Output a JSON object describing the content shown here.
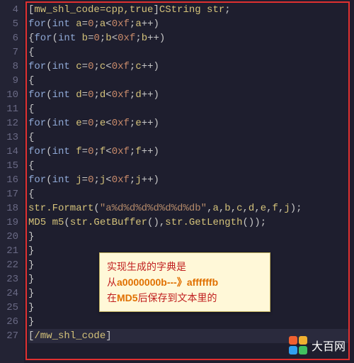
{
  "gutter": {
    "start": 4,
    "end": 27
  },
  "code_lines": {
    "l4": "[mw_shl_code=cpp,true]CString str;",
    "l5": "for(int a=0;a<0xf;a++)",
    "l6": "{for(int b=0;b<0xf;b++)",
    "l7": "{",
    "l8": "for(int c=0;c<0xf;c++)",
    "l9": "{",
    "l10": "for(int d=0;d<0xf;d++)",
    "l11": "{",
    "l12": "for(int e=0;e<0xf;e++)",
    "l13": "{",
    "l14": "for(int f=0;f<0xf;f++)",
    "l15": "{",
    "l16": "for(int j=0;j<0xf;j++)",
    "l17": "{",
    "l18": "str.Formart(\"a%d%d%d%d%d%d%db\",a,b,c,d,e,f,j);",
    "l19": "MD5 m5(str.GetBuffer(),str.GetLength());",
    "l20": "}",
    "l21": "}",
    "l22": "}",
    "l23": "}",
    "l24": "}",
    "l25": "}",
    "l26": "}",
    "l27": "[/mw_shl_code]"
  },
  "note": {
    "line1_a": "实现生成的字典是",
    "line2_a": "从",
    "line2_b": "a0000000b---》affffffb",
    "line3_a": "在",
    "line3_b": "MD5",
    "line3_c": "后保存到文本里的"
  },
  "watermark": {
    "text": "大百网"
  }
}
